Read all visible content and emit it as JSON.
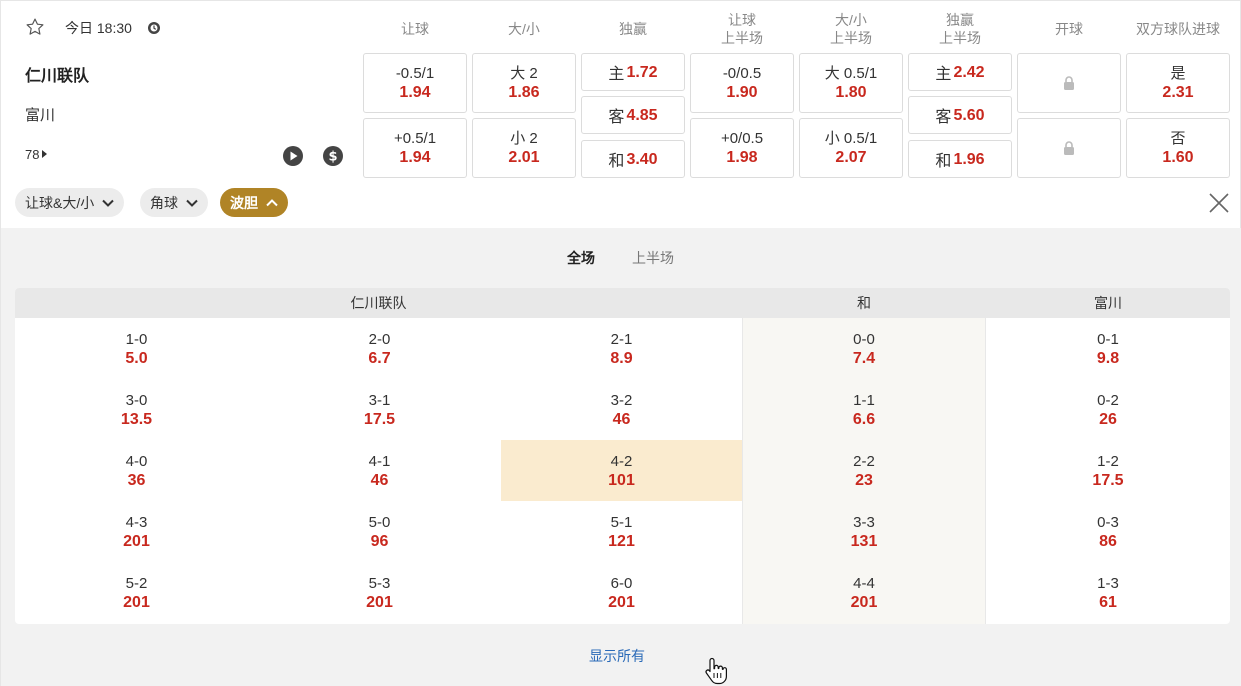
{
  "match": {
    "time": "今日 18:30",
    "home": "仁川联队",
    "away": "富川",
    "minute": "78"
  },
  "markets": {
    "headers": [
      {
        "l1": "让球",
        "l2": ""
      },
      {
        "l1": "大/小",
        "l2": ""
      },
      {
        "l1": "独赢",
        "l2": ""
      },
      {
        "l1": "让球",
        "l2": "上半场"
      },
      {
        "l1": "大/小",
        "l2": "上半场"
      },
      {
        "l1": "独赢",
        "l2": "上半场"
      },
      {
        "l1": "开球",
        "l2": ""
      },
      {
        "l1": "双方球队进球",
        "l2": ""
      }
    ],
    "handicap": [
      {
        "line": "-0.5/1",
        "price": "1.94"
      },
      {
        "line": "+0.5/1",
        "price": "1.94"
      }
    ],
    "total": [
      {
        "line": "大 2",
        "price": "1.86"
      },
      {
        "line": "小 2",
        "price": "2.01"
      }
    ],
    "moneyline": [
      {
        "label": "主",
        "price": "1.72"
      },
      {
        "label": "客",
        "price": "4.85"
      },
      {
        "label": "和",
        "price": "3.40"
      }
    ],
    "handicap_1h": [
      {
        "line": "-0/0.5",
        "price": "1.90"
      },
      {
        "line": "+0/0.5",
        "price": "1.98"
      }
    ],
    "total_1h": [
      {
        "line": "大 0.5/1",
        "price": "1.80"
      },
      {
        "line": "小 0.5/1",
        "price": "2.07"
      }
    ],
    "moneyline_1h": [
      {
        "label": "主",
        "price": "2.42"
      },
      {
        "label": "客",
        "price": "5.60"
      },
      {
        "label": "和",
        "price": "1.96"
      }
    ],
    "btts": [
      {
        "line": "是",
        "price": "2.31"
      },
      {
        "line": "否",
        "price": "1.60"
      }
    ]
  },
  "filters": {
    "chip1": "让球&大/小",
    "chip2": "角球",
    "chip3": "波胆"
  },
  "panel": {
    "tabs": [
      "全场",
      "上半场"
    ],
    "col_home": "仁川联队",
    "col_draw": "和",
    "col_away": "富川",
    "rows": [
      [
        {
          "s": "1-0",
          "p": "5.0"
        },
        {
          "s": "2-0",
          "p": "6.7"
        },
        {
          "s": "2-1",
          "p": "8.9"
        },
        {
          "s": "0-0",
          "p": "7.4"
        },
        {
          "s": "0-1",
          "p": "9.8"
        }
      ],
      [
        {
          "s": "3-0",
          "p": "13.5"
        },
        {
          "s": "3-1",
          "p": "17.5"
        },
        {
          "s": "3-2",
          "p": "46"
        },
        {
          "s": "1-1",
          "p": "6.6"
        },
        {
          "s": "0-2",
          "p": "26"
        }
      ],
      [
        {
          "s": "4-0",
          "p": "36"
        },
        {
          "s": "4-1",
          "p": "46"
        },
        {
          "s": "4-2",
          "p": "101"
        },
        {
          "s": "2-2",
          "p": "23"
        },
        {
          "s": "1-2",
          "p": "17.5"
        }
      ],
      [
        {
          "s": "4-3",
          "p": "201"
        },
        {
          "s": "5-0",
          "p": "96"
        },
        {
          "s": "5-1",
          "p": "121"
        },
        {
          "s": "3-3",
          "p": "131"
        },
        {
          "s": "0-3",
          "p": "86"
        }
      ],
      [
        {
          "s": "5-2",
          "p": "201"
        },
        {
          "s": "5-3",
          "p": "201"
        },
        {
          "s": "6-0",
          "p": "201"
        },
        {
          "s": "4-4",
          "p": "201"
        },
        {
          "s": "1-3",
          "p": "61"
        }
      ]
    ],
    "highlighted": "4-2",
    "show_all": "显示所有"
  },
  "colors": {
    "price": "#c8281e",
    "active_chip": "#b08426",
    "highlight": "#faebcf",
    "link": "#2a6ab8"
  }
}
